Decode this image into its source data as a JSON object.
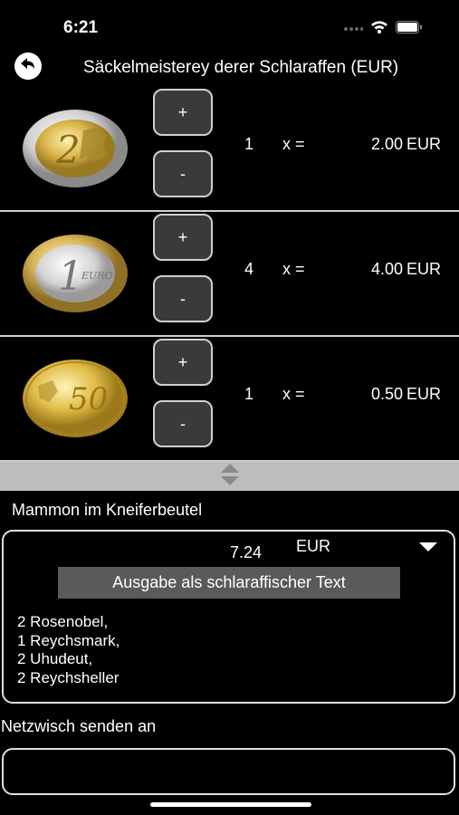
{
  "status": {
    "time": "6:21"
  },
  "nav": {
    "title": "Säckelmeisterey derer Schlaraffen (EUR)"
  },
  "coins": [
    {
      "denomination": "2",
      "plus": "+",
      "minus": "-",
      "qty": "1",
      "times": "x =",
      "amount": "2.00",
      "currency": "EUR"
    },
    {
      "denomination": "1",
      "plus": "+",
      "minus": "-",
      "qty": "4",
      "times": "x =",
      "amount": "4.00",
      "currency": "EUR"
    },
    {
      "denomination": "50",
      "plus": "+",
      "minus": "-",
      "qty": "1",
      "times": "x =",
      "amount": "0.50",
      "currency": "EUR"
    }
  ],
  "result": {
    "label": "Mammon im Kneiferbeutel",
    "total": "7.24",
    "currency": "EUR",
    "button": "Ausgabe als schlaraffischer Text",
    "lines": [
      "2 Rosenobel,",
      "1 Reychsmark,",
      "2 Uhudeut,",
      "2 Reychsheller"
    ]
  },
  "send": {
    "label": "Netzwisch senden an",
    "value": ""
  }
}
